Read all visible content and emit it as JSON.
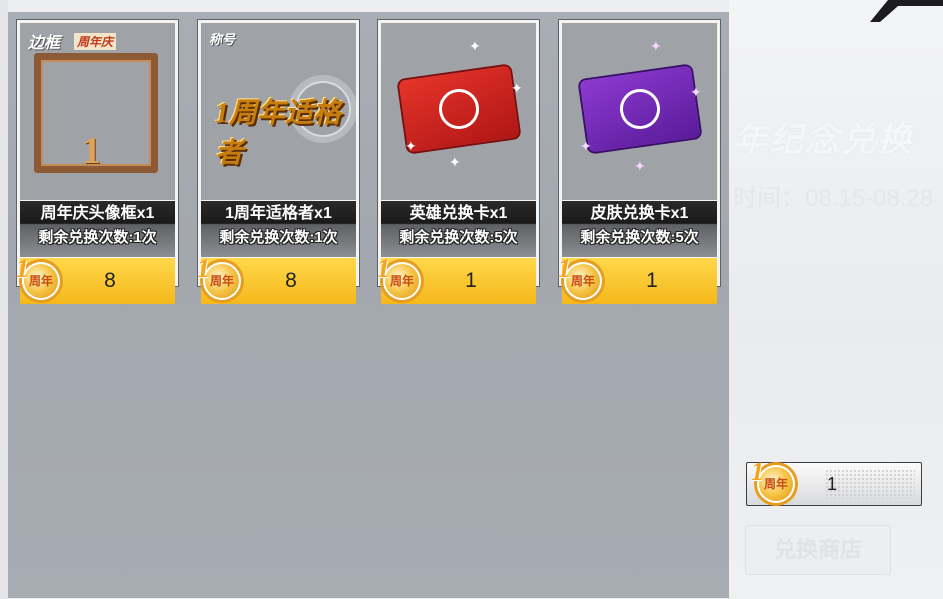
{
  "shop": {
    "items": [
      {
        "name": "周年庆头像框x1",
        "remaining": "剩余兑换次数:1次",
        "price": "8",
        "art_tag": "边框",
        "art_subtag": "周年庆",
        "art_text": "1"
      },
      {
        "name": "1周年适格者x1",
        "remaining": "剩余兑换次数:1次",
        "price": "8",
        "art_tag": "称号",
        "art_text": "1周年适格者"
      },
      {
        "name": "英雄兑换卡x1",
        "remaining": "剩余兑换次数:5次",
        "price": "1"
      },
      {
        "name": "皮肤兑换卡x1",
        "remaining": "剩余兑换次数:5次",
        "price": "1"
      }
    ],
    "currency_icon": "anniversary-coin-icon",
    "currency_label": "周年"
  },
  "side": {
    "header_art_text": "年纪念兑换",
    "time_text": "时间：08.15-08.28",
    "balance": "1",
    "shop_button_label": "兑换商店"
  },
  "colors": {
    "panel_bg": "#a7abb2",
    "price_bar": "#f5b81b",
    "red_ticket": "#d42a22",
    "purple_ticket": "#7a2fbd"
  }
}
